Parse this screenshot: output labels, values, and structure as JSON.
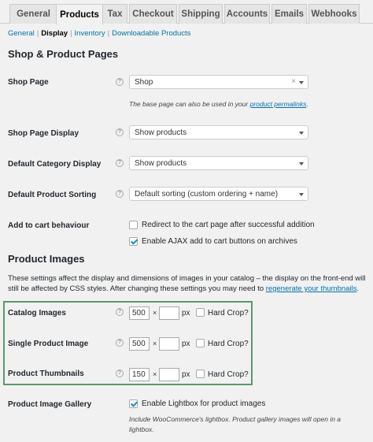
{
  "tabs": [
    {
      "label": "General"
    },
    {
      "label": "Products"
    },
    {
      "label": "Tax"
    },
    {
      "label": "Checkout"
    },
    {
      "label": "Shipping"
    },
    {
      "label": "Accounts"
    },
    {
      "label": "Emails"
    },
    {
      "label": "Webhooks"
    }
  ],
  "active_tab": "Products",
  "subnav": {
    "general": "General",
    "display": "Display",
    "inventory": "Inventory",
    "downloadable": "Downloadable Products",
    "separator": "|"
  },
  "shop_section": {
    "title": "Shop & Product Pages",
    "shop_page": {
      "label": "Shop Page",
      "value": "Shop",
      "clear": "×",
      "desc_prefix": "The base page can also be used in your ",
      "desc_link": "product permalinks",
      "desc_suffix": "."
    },
    "shop_page_display": {
      "label": "Shop Page Display",
      "value": "Show products"
    },
    "category_display": {
      "label": "Default Category Display",
      "value": "Show products"
    },
    "product_sorting": {
      "label": "Default Product Sorting",
      "value": "Default sorting (custom ordering + name)"
    },
    "add_to_cart": {
      "label": "Add to cart behaviour",
      "redirect": {
        "label": "Redirect to the cart page after successful addition",
        "checked": false
      },
      "ajax": {
        "label": "Enable AJAX add to cart buttons on archives",
        "checked": true
      }
    }
  },
  "images_section": {
    "title": "Product Images",
    "desc_text": "These settings affect the display and dimensions of images in your catalog – the display on the front-end will still be affected by CSS styles. After changing these settings you may need to ",
    "desc_link": "regenerate your thumbnails",
    "desc_suffix": ".",
    "times": "×",
    "px": "px",
    "hard_crop": "Hard Crop?",
    "catalog": {
      "label": "Catalog Images",
      "width": "500",
      "height": "",
      "hard_crop": false
    },
    "single": {
      "label": "Single Product Image",
      "width": "500",
      "height": "",
      "hard_crop": false
    },
    "thumbnails": {
      "label": "Product Thumbnails",
      "width": "150",
      "height": "",
      "hard_crop": false
    },
    "gallery": {
      "label": "Product Image Gallery",
      "checkbox_label": "Enable Lightbox for product images",
      "checked": true,
      "desc_line1": "Include WooCommerce's lightbox. Product gallery images will open in a",
      "desc_line2": "lightbox."
    }
  },
  "help_glyph": "?",
  "colors": {
    "link": "#0073aa",
    "highlight": "#5a9a6a",
    "checkmark": "#1e8cbe"
  }
}
